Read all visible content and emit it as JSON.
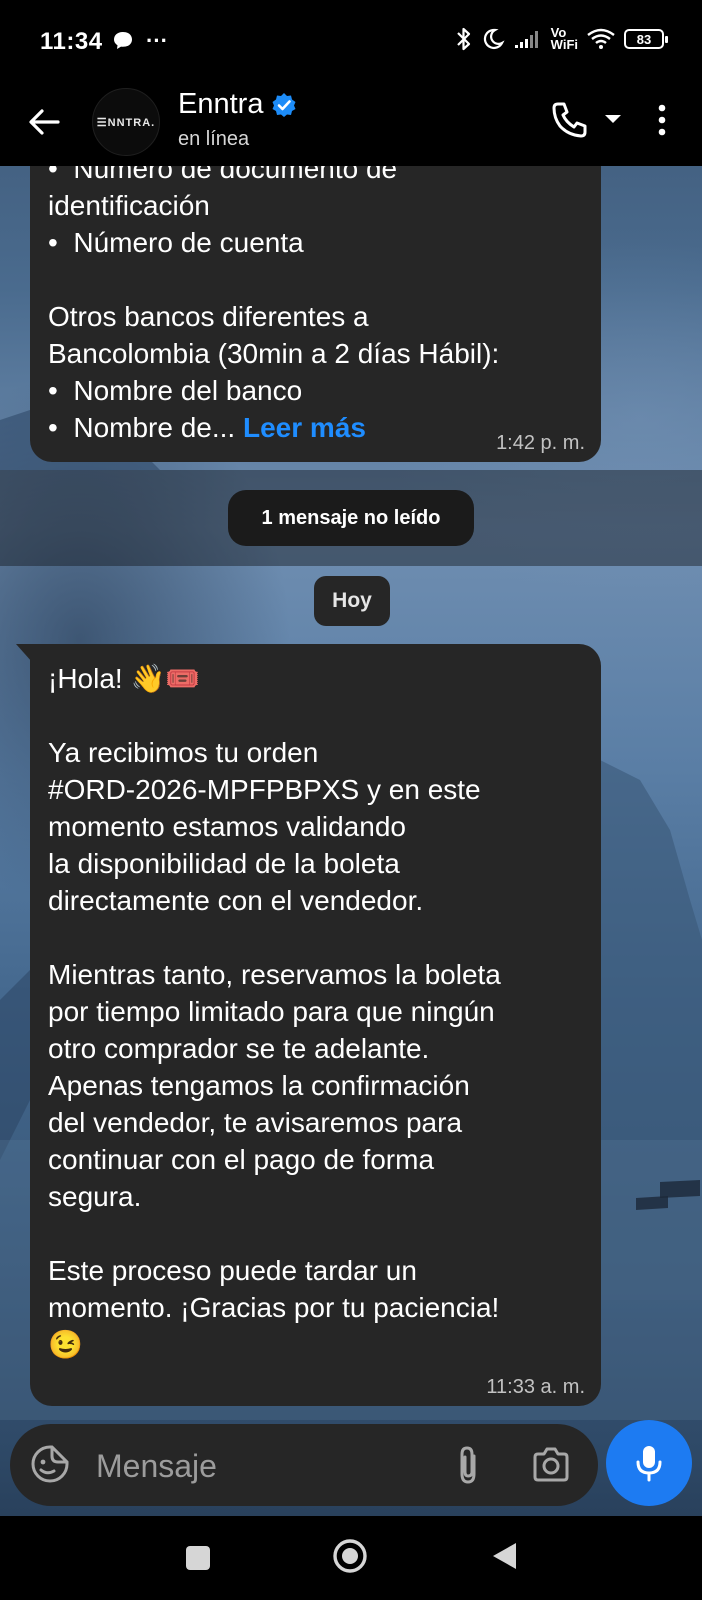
{
  "status_bar": {
    "time": "11:34",
    "more": "···",
    "vowifi_top": "Vo",
    "vowifi_bottom": "WiFi",
    "battery": "83"
  },
  "header": {
    "contact_name": "Enntra",
    "contact_status": "en línea",
    "avatar_text": "☰NNTRA."
  },
  "messages": [
    {
      "text": "•  Número de documento de\nidentificación\n•  Número de cuenta\n\nOtros bancos diferentes a\nBancolombia (30min a 2 días Hábil):\n•  Nombre del banco\n•  Nombre de... ",
      "read_more": "Leer más",
      "time": "1:42 p. m."
    },
    {
      "text": "¡Hola! 👋🎟️\n\nYa recibimos tu orden\n#ORD-2026-MPFPBPXS y en este\nmomento estamos validando\nla disponibilidad de la boleta\ndirectamente con el vendedor.\n\nMientras tanto, reservamos la boleta\npor tiempo limitado para que ningún\notro comprador se te adelante.\nApenas tengamos la confirmación\ndel vendedor, te avisaremos para\ncontinuar con el pago de forma\nsegura.\n\nEste proceso puede tardar un\nmomento. ¡Gracias por tu paciencia!\n😉",
      "time": "11:33 a. m."
    }
  ],
  "unread_divider": "1 mensaje no leído",
  "date_divider": "Hoy",
  "composer": {
    "placeholder": "Mensaje"
  },
  "colors": {
    "accent": "#1d7bf2",
    "bubble": "#262626",
    "link": "#1f8dff"
  }
}
